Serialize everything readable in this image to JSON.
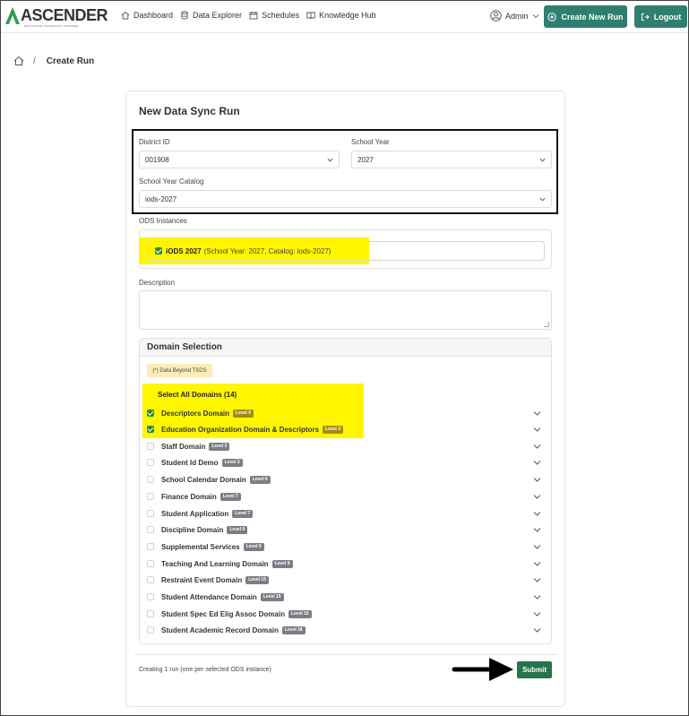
{
  "brand": {
    "name": "ASCENDER",
    "tagline": "EDUCATIONAL TECHNOLOGY SOFTWARE"
  },
  "nav": {
    "links": [
      "Dashboard",
      "Data Explorer",
      "Schedules",
      "Knowledge Hub"
    ],
    "user": "Admin",
    "new_run_label": "Create New Run",
    "logout_label": "Logout"
  },
  "breadcrumb": {
    "current": "Create Run",
    "separator": "/"
  },
  "form": {
    "title": "New Data Sync Run",
    "district_label": "District ID",
    "district_value": "001908",
    "year_label": "School Year",
    "year_value": "2027",
    "catalog_label": "School Year Catalog",
    "catalog_value": "iods-2027",
    "ods_label": "ODS Instances",
    "ods_instance": {
      "name": "iODS 2027",
      "meta": "(School Year: 2027, Catalog: iods-2027)",
      "checked": true
    },
    "description_label": "Description",
    "domain_section_title": "Domain Selection",
    "beyond_note": "(*) Data Beyond TSDS",
    "select_all_label": "Select All Domains (14)",
    "domains": [
      {
        "name": "Descriptors Domain",
        "level": "Level 0",
        "checked": true
      },
      {
        "name": "Education Organization Domain & Descriptors",
        "level": "Level 3",
        "checked": true
      },
      {
        "name": "Staff Domain",
        "level": "Level 3",
        "checked": false
      },
      {
        "name": "Student Id Demo",
        "level": "Level 3",
        "checked": false
      },
      {
        "name": "School Calendar Domain",
        "level": "Level 6",
        "checked": false
      },
      {
        "name": "Finance Domain",
        "level": "Level 7",
        "checked": false
      },
      {
        "name": "Student Application",
        "level": "Level 7",
        "checked": false
      },
      {
        "name": "Discipline Domain",
        "level": "Level 9",
        "checked": false
      },
      {
        "name": "Supplemental Services",
        "level": "Level 9",
        "checked": false
      },
      {
        "name": "Teaching And Learning Domain",
        "level": "Level 9",
        "checked": false
      },
      {
        "name": "Restraint Event Domain",
        "level": "Level 15",
        "checked": false
      },
      {
        "name": "Student Attendance Domain",
        "level": "Level 15",
        "checked": false
      },
      {
        "name": "Student Spec Ed Elig Assoc Domain",
        "level": "Level 15",
        "checked": false
      },
      {
        "name": "Student Academic Record Domain",
        "level": "Level 18",
        "checked": false
      }
    ],
    "footnote": "Creating 1 run (one per selected ODS instance)",
    "submit_label": "Submit"
  },
  "colors": {
    "primary": "#2f7f70",
    "submit": "#24744c",
    "highlight": "#fff600",
    "check": "#2b8a3e"
  }
}
